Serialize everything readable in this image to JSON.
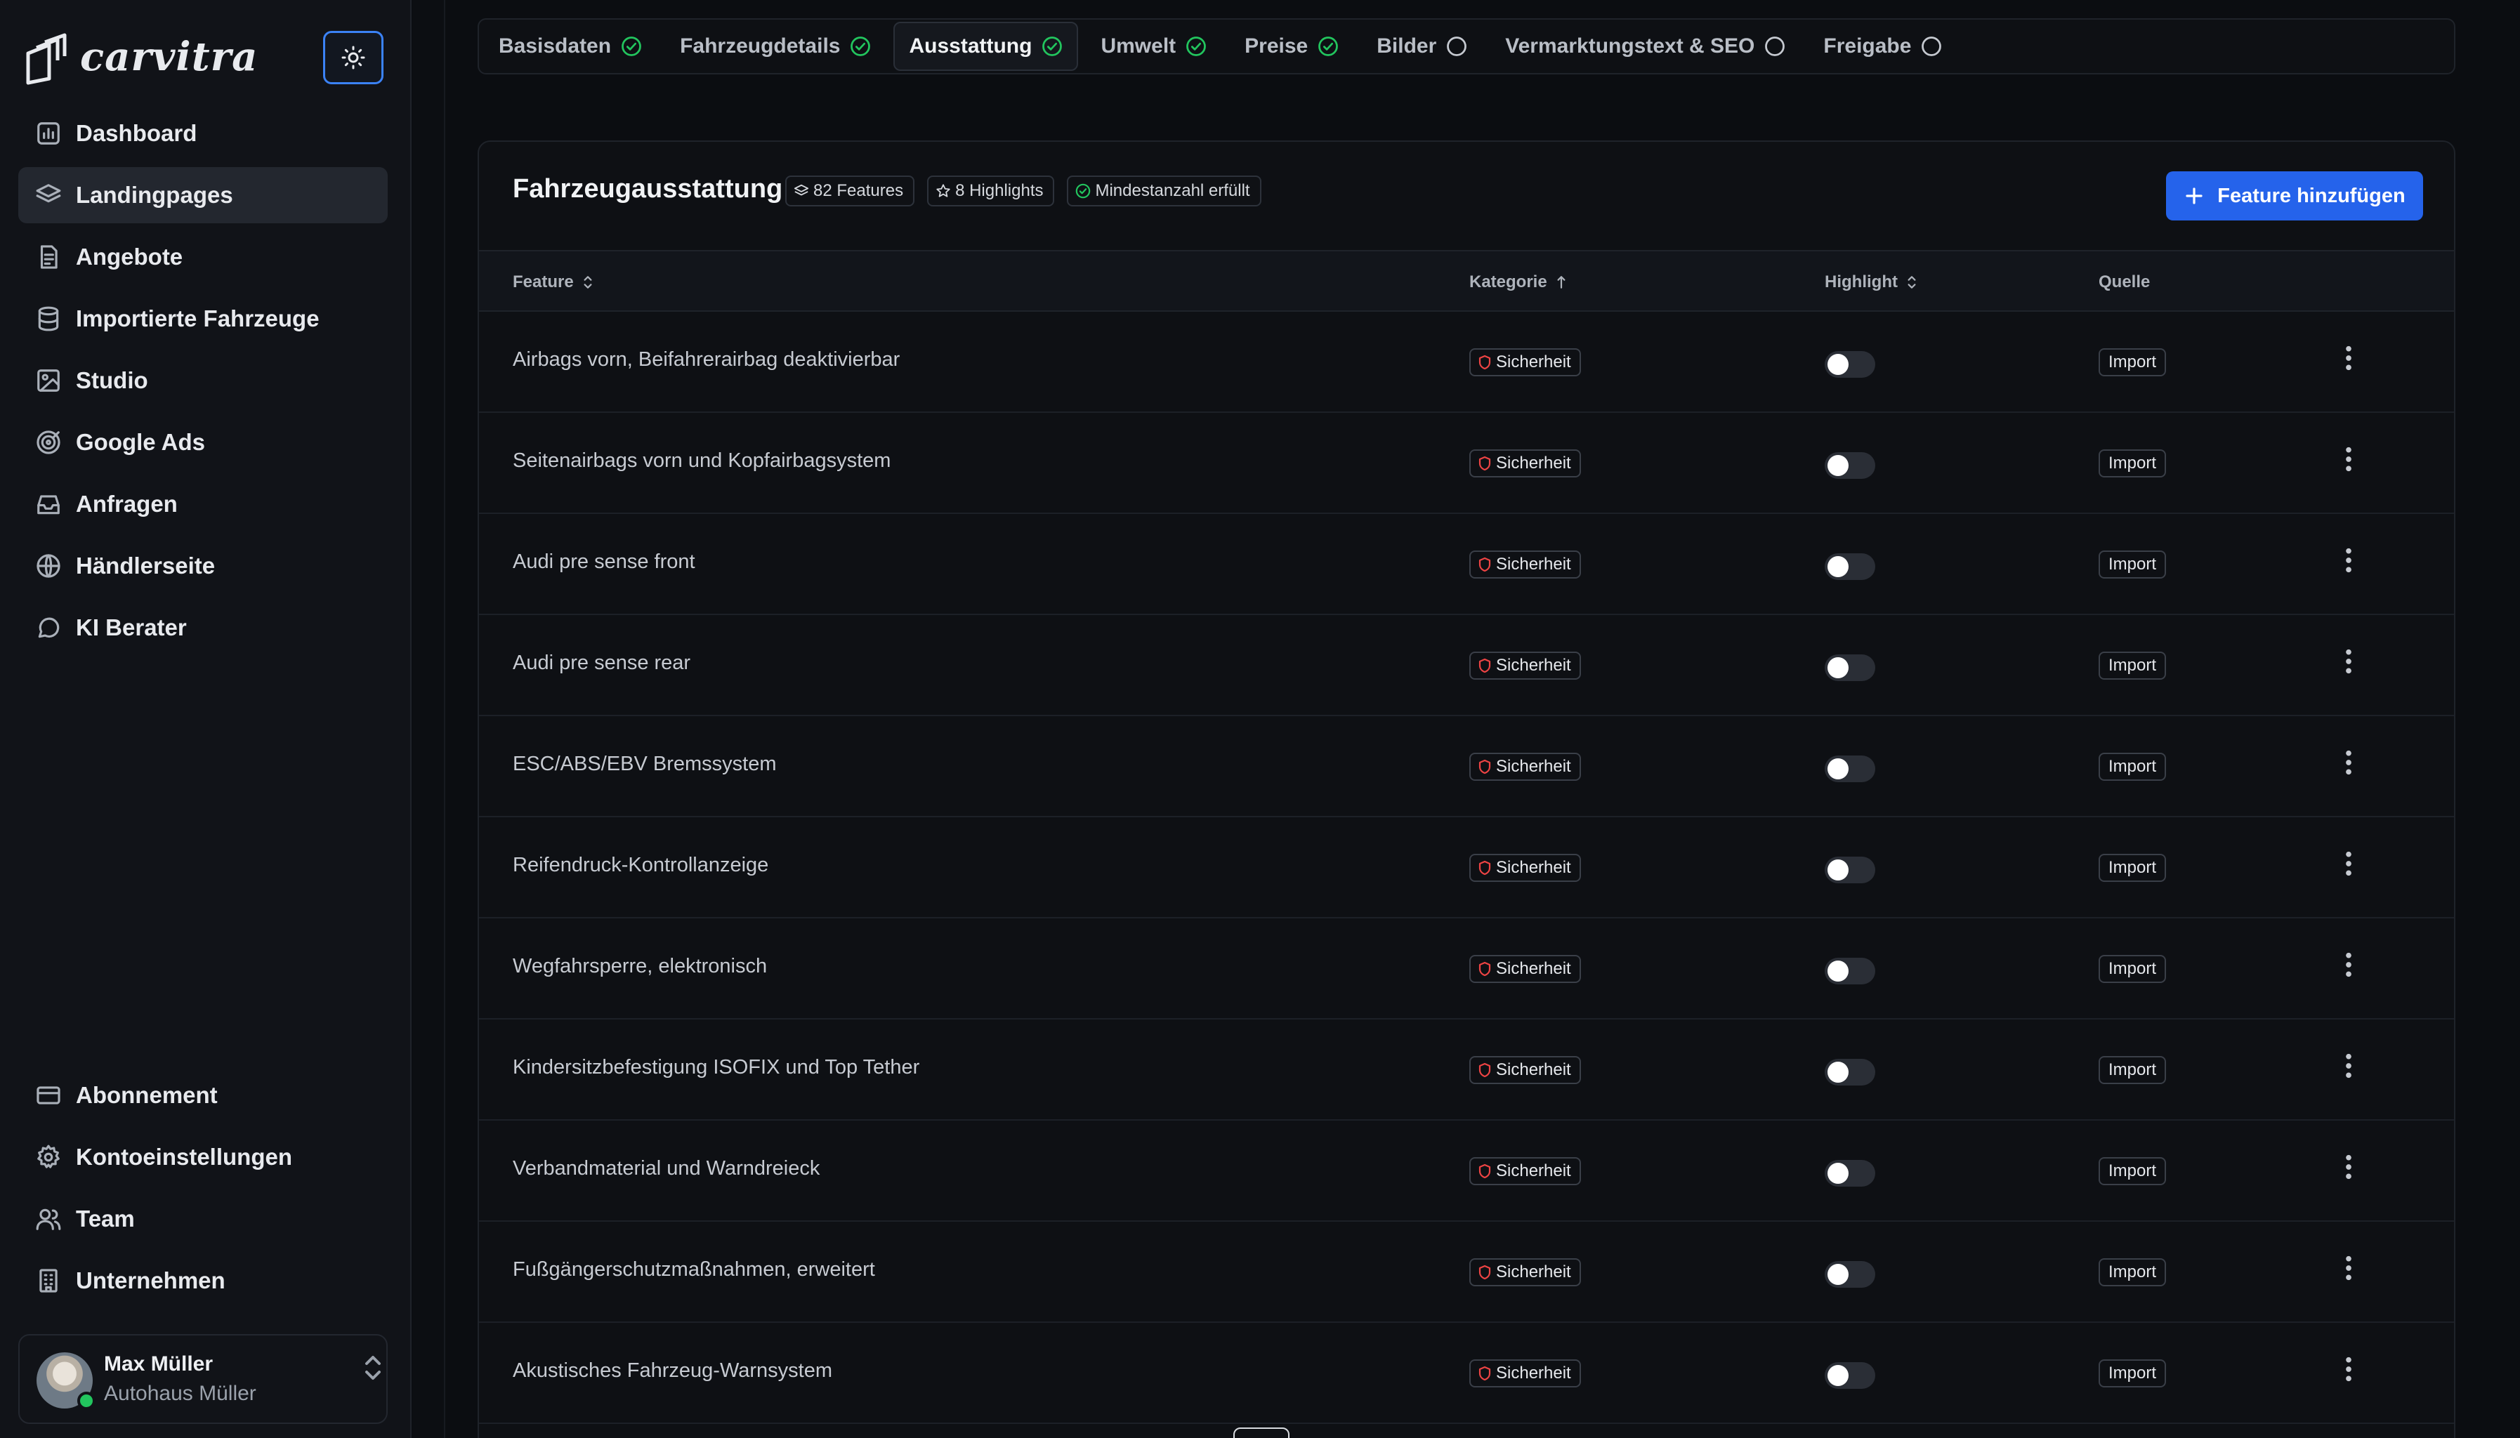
{
  "app": {
    "brand": "carvitra"
  },
  "sidebar": {
    "items": [
      {
        "label": "Dashboard",
        "icon": "chart-icon",
        "active": false
      },
      {
        "label": "Landingpages",
        "icon": "layers-icon",
        "active": true
      },
      {
        "label": "Angebote",
        "icon": "document-icon",
        "active": false
      },
      {
        "label": "Importierte Fahrzeuge",
        "icon": "database-icon",
        "active": false
      },
      {
        "label": "Studio",
        "icon": "image-icon",
        "active": false
      },
      {
        "label": "Google Ads",
        "icon": "target-icon",
        "active": false
      },
      {
        "label": "Anfragen",
        "icon": "inbox-icon",
        "active": false
      },
      {
        "label": "Händlerseite",
        "icon": "globe-icon",
        "active": false
      },
      {
        "label": "KI Berater",
        "icon": "chat-icon",
        "active": false
      }
    ],
    "bottom_items": [
      {
        "label": "Abonnement",
        "icon": "credit-card-icon"
      },
      {
        "label": "Kontoeinstellungen",
        "icon": "gear-icon"
      },
      {
        "label": "Team",
        "icon": "users-icon"
      },
      {
        "label": "Unternehmen",
        "icon": "building-icon"
      }
    ],
    "user": {
      "name": "Max Müller",
      "org": "Autohaus Müller",
      "online_color": "#22c55e"
    }
  },
  "tabs": [
    {
      "label": "Basisdaten",
      "status": "done"
    },
    {
      "label": "Fahrzeugdetails",
      "status": "done"
    },
    {
      "label": "Ausstattung",
      "status": "done",
      "active": true
    },
    {
      "label": "Umwelt",
      "status": "done"
    },
    {
      "label": "Preise",
      "status": "done"
    },
    {
      "label": "Bilder",
      "status": "open"
    },
    {
      "label": "Vermarktungstext & SEO",
      "status": "open"
    },
    {
      "label": "Freigabe",
      "status": "open"
    }
  ],
  "equipment": {
    "title": "Fahrzeugausstattung",
    "badges": {
      "features": "82 Features",
      "highlights": "8 Highlights",
      "minimum": "Mindestanzahl erfüllt"
    },
    "add_button": "Feature hinzufügen",
    "columns": {
      "feature": "Feature",
      "category": "Kategorie",
      "highlight": "Highlight",
      "source": "Quelle"
    },
    "rows": [
      {
        "feature": "Airbags vorn, Beifahrerairbag deaktivierbar",
        "category": "Sicherheit",
        "highlight": false,
        "source": "Import"
      },
      {
        "feature": "Seitenairbags vorn und Kopfairbagsystem",
        "category": "Sicherheit",
        "highlight": false,
        "source": "Import"
      },
      {
        "feature": "Audi pre sense front",
        "category": "Sicherheit",
        "highlight": false,
        "source": "Import"
      },
      {
        "feature": "Audi pre sense rear",
        "category": "Sicherheit",
        "highlight": false,
        "source": "Import"
      },
      {
        "feature": "ESC/ABS/EBV Bremssystem",
        "category": "Sicherheit",
        "highlight": false,
        "source": "Import"
      },
      {
        "feature": "Reifendruck-Kontrollanzeige",
        "category": "Sicherheit",
        "highlight": false,
        "source": "Import"
      },
      {
        "feature": "Wegfahrsperre, elektronisch",
        "category": "Sicherheit",
        "highlight": false,
        "source": "Import"
      },
      {
        "feature": "Kindersitzbefestigung ISOFIX und Top Tether",
        "category": "Sicherheit",
        "highlight": false,
        "source": "Import"
      },
      {
        "feature": "Verbandmaterial und Warndreieck",
        "category": "Sicherheit",
        "highlight": false,
        "source": "Import"
      },
      {
        "feature": "Fußgängerschutzmaßnahmen, erweitert",
        "category": "Sicherheit",
        "highlight": false,
        "source": "Import"
      },
      {
        "feature": "Akustisches Fahrzeug-Warnsystem",
        "category": "Sicherheit",
        "highlight": false,
        "source": "Import"
      }
    ]
  },
  "colors": {
    "accent": "#2563eb",
    "focus_ring": "#3b82f6",
    "success": "#22c55e",
    "safety": "#ef4444"
  }
}
